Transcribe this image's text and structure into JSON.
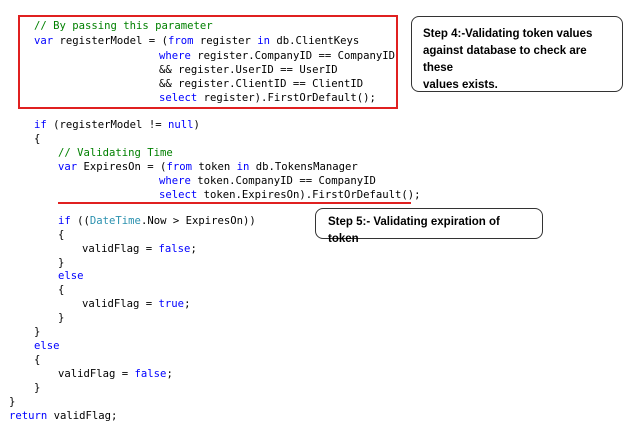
{
  "code": {
    "lines": [
      [
        "// By passing this parameter"
      ],
      [
        "var",
        " registerModel = (",
        "from",
        " register ",
        "in",
        " db.ClientKeys"
      ],
      [
        "where",
        " register.CompanyID == CompanyID"
      ],
      [
        "&& register.UserID == UserID"
      ],
      [
        "&& register.ClientID == ClientID"
      ],
      [
        "select",
        " register).FirstOrDefault();"
      ],
      [
        "if",
        " (registerModel != ",
        "null",
        ")"
      ],
      [
        "{"
      ],
      [
        "// Validating Time"
      ],
      [
        "var",
        " ExpiresOn = (",
        "from",
        " token ",
        "in",
        " db.TokensManager"
      ],
      [
        "where",
        " token.CompanyID == CompanyID"
      ],
      [
        "select",
        " token.ExpiresOn).FirstOrDefault();"
      ],
      [
        "if",
        " ((",
        "DateTime",
        ".Now > ExpiresOn))"
      ],
      [
        "{"
      ],
      [
        "validFlag = ",
        "false",
        ";"
      ],
      [
        "}"
      ],
      [
        "else"
      ],
      [
        "{"
      ],
      [
        "validFlag = ",
        "true",
        ";"
      ],
      [
        "}"
      ],
      [
        "}"
      ],
      [
        "else"
      ],
      [
        "{"
      ],
      [
        "validFlag = ",
        "false",
        ";"
      ],
      [
        "}"
      ],
      [
        "}"
      ],
      [
        "return",
        " validFlag;"
      ]
    ]
  },
  "annotations": {
    "step4": {
      "line1": "Step 4:-Validating token values",
      "line2": "against database to check are these",
      "line3": "values exists."
    },
    "step5": {
      "text": "Step 5:- Validating expiration of token"
    }
  },
  "colors": {
    "keyword": "#0000ff",
    "comment": "#008000",
    "type": "#2b91af",
    "highlight": "#e02020"
  }
}
